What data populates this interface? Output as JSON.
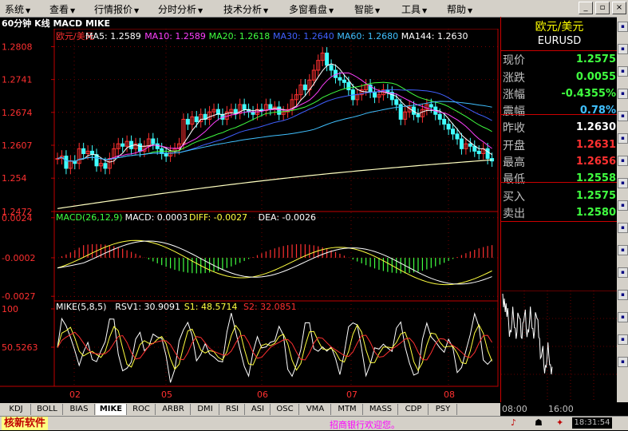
{
  "menu": [
    "系统",
    "查看",
    "行情报价",
    "分时分析",
    "技术分析",
    "多窗看盘",
    "智能",
    "工具",
    "帮助"
  ],
  "chart_title": "60分钟 K线 MACD MIKE",
  "main_legend": [
    {
      "text": "欧元/美元",
      "color": "#ff3030"
    },
    {
      "text": "MA5: 1.2589",
      "color": "#ffffff"
    },
    {
      "text": "MA10: 1.2589",
      "color": "#ff40ff"
    },
    {
      "text": "MA20: 1.2618",
      "color": "#40ff40"
    },
    {
      "text": "MA30: 1.2640",
      "color": "#4060ff"
    },
    {
      "text": "MA60: 1.2680",
      "color": "#40c0ff"
    },
    {
      "text": "MA144: 1.2630",
      "color": "#ffffff"
    }
  ],
  "macd_legend": [
    {
      "text": "MACD(26,12,9)",
      "color": "#40ff40"
    },
    {
      "text": "MACD: 0.0003",
      "color": "#ffffff"
    },
    {
      "text": "DIFF: -0.0027",
      "color": "#ffff40"
    },
    {
      "text": "DEA: -0.0026",
      "color": "#ffffff"
    }
  ],
  "mike_legend": [
    {
      "text": "MIKE(5,8,5)",
      "color": "#ffffff"
    },
    {
      "text": "RSV1: 30.9091",
      "color": "#ffffff"
    },
    {
      "text": "S1: 48.5714",
      "color": "#ffff40"
    },
    {
      "text": "S2: 32.0851",
      "color": "#ff3030"
    }
  ],
  "right_panel": {
    "title": "欧元/美元",
    "code": "EURUSD",
    "rows": [
      {
        "label": "现价",
        "value": "1.2575",
        "color": "#40ff40"
      },
      {
        "label": "涨跌",
        "value": "0.0055",
        "color": "#40ff40"
      },
      {
        "label": "涨幅",
        "value": "-0.4355%",
        "color": "#40ff40"
      },
      {
        "label": "震幅",
        "value": "0.78%",
        "color": "#40c0ff"
      },
      {
        "label": "昨收",
        "value": "1.2630",
        "color": "#ffffff"
      },
      {
        "label": "开盘",
        "value": "1.2631",
        "color": "#ff3030"
      },
      {
        "label": "最高",
        "value": "1.2656",
        "color": "#ff3030"
      },
      {
        "label": "最低",
        "value": "1.2558",
        "color": "#40ff40"
      },
      {
        "label": "买入",
        "value": "1.2575",
        "color": "#40ff40"
      },
      {
        "label": "卖出",
        "value": "1.2580",
        "color": "#40ff40"
      }
    ],
    "mini_times": [
      "08:00",
      "16:00"
    ]
  },
  "tabs": [
    "KDJ",
    "BOLL",
    "BIAS",
    "MIKE",
    "ROC",
    "ARBR",
    "DMI",
    "RSI",
    "ASI",
    "OSC",
    "VMA",
    "MTM",
    "MASS",
    "CDP",
    "PSY"
  ],
  "active_tab": "MIKE",
  "status": {
    "brand": "核新软件",
    "ticker": "招商银行欢迎您。",
    "time": "18:31:54"
  },
  "colors": {
    "up": "#ff3030",
    "down": "#40ffff",
    "grid": "#c00000",
    "axis_text": "#ff3030"
  },
  "chart_data": [
    {
      "type": "candlestick",
      "title": "欧元/美元",
      "yticks": [
        1.2808,
        1.2741,
        1.2674,
        1.2607,
        1.254,
        1.2472
      ],
      "ylim": [
        1.2472,
        1.2825
      ],
      "xticks": [
        "02",
        "05",
        "06",
        "07",
        "08"
      ],
      "series": [
        {
          "name": "MA5",
          "value": 1.2589
        },
        {
          "name": "MA10",
          "value": 1.2589
        },
        {
          "name": "MA20",
          "value": 1.2618
        },
        {
          "name": "MA30",
          "value": 1.264
        },
        {
          "name": "MA60",
          "value": 1.268
        },
        {
          "name": "MA144",
          "value": 1.263
        }
      ],
      "closes": [
        1.258,
        1.2585,
        1.256,
        1.2575,
        1.257,
        1.26,
        1.259,
        1.2595,
        1.2588,
        1.2565,
        1.257,
        1.256,
        1.258,
        1.26,
        1.261,
        1.2605,
        1.2615,
        1.26,
        1.261,
        1.2595,
        1.2605,
        1.262,
        1.261,
        1.26,
        1.259,
        1.2585,
        1.2595,
        1.26,
        1.261,
        1.266,
        1.265,
        1.2665,
        1.2655,
        1.267,
        1.266,
        1.2675,
        1.268,
        1.267,
        1.266,
        1.2675,
        1.268,
        1.2672,
        1.269,
        1.268,
        1.2675,
        1.267,
        1.268,
        1.2678,
        1.269,
        1.268,
        1.2685,
        1.267,
        1.2675,
        1.268,
        1.27,
        1.271,
        1.273,
        1.272,
        1.274,
        1.276,
        1.278,
        1.2795,
        1.277,
        1.276,
        1.2745,
        1.274,
        1.2735,
        1.272,
        1.27,
        1.271,
        1.272,
        1.273,
        1.2715,
        1.2705,
        1.271,
        1.272,
        1.2715,
        1.27,
        1.269,
        1.266,
        1.2675,
        1.2685,
        1.267,
        1.2665,
        1.268,
        1.269,
        1.2685,
        1.267,
        1.266,
        1.265,
        1.264,
        1.263,
        1.262,
        1.26,
        1.261,
        1.2605,
        1.2595,
        1.259,
        1.26,
        1.258,
        1.2575
      ]
    },
    {
      "type": "bar",
      "title": "MACD(26,12,9)",
      "yticks": [
        0.0024,
        -0.0002,
        -0.0027
      ],
      "ylim": [
        -0.003,
        0.0027
      ],
      "series": [
        {
          "name": "MACD",
          "value": 0.0003
        },
        {
          "name": "DIFF",
          "value": -0.0027
        },
        {
          "name": "DEA",
          "value": -0.0026
        }
      ]
    },
    {
      "type": "line",
      "title": "MIKE(5,8,5)",
      "yticks": [
        100.0,
        50.5263
      ],
      "ylim": [
        0,
        100
      ],
      "series": [
        {
          "name": "RSV1",
          "value": 30.9091
        },
        {
          "name": "S1",
          "value": 48.5714
        },
        {
          "name": "S2",
          "value": 32.0851
        }
      ]
    }
  ]
}
